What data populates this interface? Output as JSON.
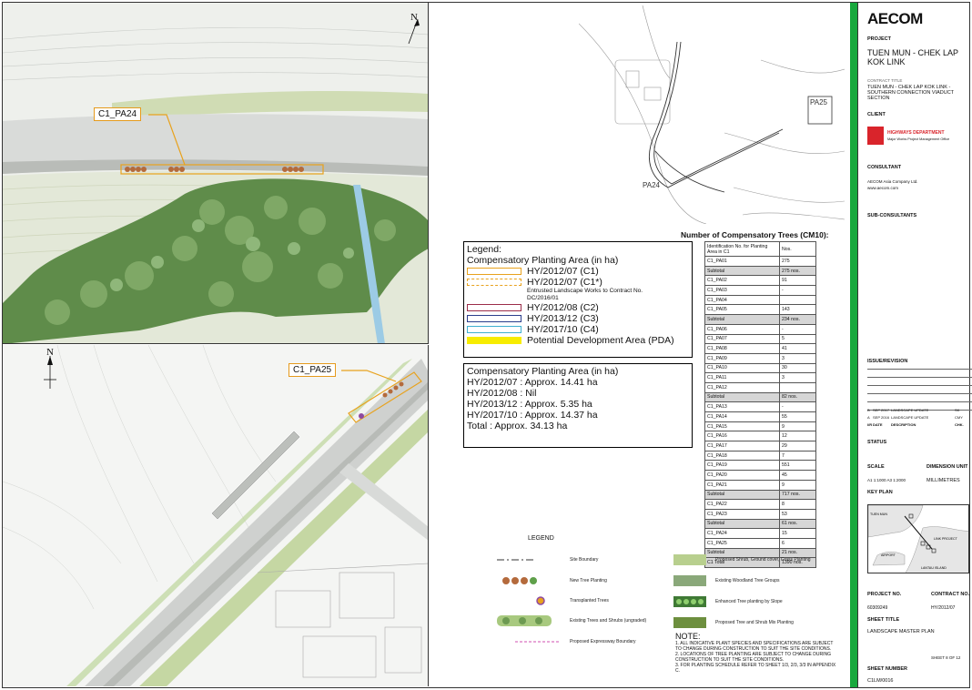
{
  "map_top": {
    "callout": "C1_PA24",
    "north_label": "N"
  },
  "map_bottom": {
    "callout": "C1_PA25",
    "north_label": "N"
  },
  "key_map": {
    "labels": [
      "PA25",
      "PA24"
    ]
  },
  "legend1": {
    "title": "Legend:",
    "subtitle": "Compensatory Planting Area (in ha)",
    "items": [
      {
        "label": "HY/2012/07 (C1)",
        "color": "#e8a21d",
        "style": "solid"
      },
      {
        "label": "HY/2012/07 (C1*)",
        "color": "#e8a21d",
        "style": "dashed"
      },
      {
        "label": "HY/2012/08 (C2)",
        "color": "#9b2d4a",
        "style": "solid"
      },
      {
        "label": "HY/2013/12 (C3)",
        "color": "#2b3e8c",
        "style": "solid"
      },
      {
        "label": "HY/2017/10 (C4)",
        "color": "#3fb0cf",
        "style": "solid"
      },
      {
        "label": "Potential Development Area (PDA)",
        "color": "#f7ec00",
        "style": "fill"
      }
    ],
    "note": "Entrusted Landscape Works to Contract No. DC/2016/01"
  },
  "legend2": {
    "title": "Compensatory Planting Area (in ha)",
    "rows": [
      "HY/2012/07 :  Approx. 14.41 ha",
      "HY/2012/08 :  Nil",
      "HY/2013/12 :  Approx. 5.35 ha",
      "HY/2017/10 :  Approx. 14.37 ha",
      "Total : Approx. 34.13 ha"
    ]
  },
  "trees_table": {
    "title": "Number of Compensatory Trees (CM10):",
    "header": [
      "Identification No. for Planting Area in C1",
      "Nos."
    ],
    "rows": [
      {
        "id": "C1_PA01",
        "n": "275",
        "sub": false
      },
      {
        "id": "Subtotal",
        "n": "275 nos.",
        "sub": true
      },
      {
        "id": "C1_PA02",
        "n": "91",
        "sub": false
      },
      {
        "id": "C1_PA03",
        "n": "-",
        "sub": false
      },
      {
        "id": "C1_PA04",
        "n": "",
        "sub": false
      },
      {
        "id": "C1_PA05",
        "n": "143",
        "sub": false
      },
      {
        "id": "Subtotal",
        "n": "234 nos.",
        "sub": true
      },
      {
        "id": "C1_PA06",
        "n": "-",
        "sub": false
      },
      {
        "id": "C1_PA07",
        "n": "5",
        "sub": false
      },
      {
        "id": "C1_PA08",
        "n": "41",
        "sub": false
      },
      {
        "id": "C1_PA09",
        "n": "3",
        "sub": false
      },
      {
        "id": "C1_PA10",
        "n": "30",
        "sub": false
      },
      {
        "id": "C1_PA11",
        "n": "3",
        "sub": false
      },
      {
        "id": "C1_PA12",
        "n": "",
        "sub": false
      },
      {
        "id": "Subtotal",
        "n": "82 nos.",
        "sub": true
      },
      {
        "id": "C1_PA13",
        "n": "-",
        "sub": false
      },
      {
        "id": "C1_PA14",
        "n": "55",
        "sub": false
      },
      {
        "id": "C1_PA15",
        "n": "9",
        "sub": false
      },
      {
        "id": "C1_PA16",
        "n": "12",
        "sub": false
      },
      {
        "id": "C1_PA17",
        "n": "29",
        "sub": false
      },
      {
        "id": "C1_PA18",
        "n": "7",
        "sub": false
      },
      {
        "id": "C1_PA19",
        "n": "551",
        "sub": false
      },
      {
        "id": "C1_PA20",
        "n": "45",
        "sub": false
      },
      {
        "id": "C1_PA21",
        "n": "9",
        "sub": false
      },
      {
        "id": "Subtotal",
        "n": "717 nos.",
        "sub": true
      },
      {
        "id": "C1_PA22",
        "n": "8",
        "sub": false
      },
      {
        "id": "C1_PA23",
        "n": "53",
        "sub": false
      },
      {
        "id": "Subtotal",
        "n": "61 nos.",
        "sub": true
      },
      {
        "id": "C1_PA24",
        "n": "15",
        "sub": false
      },
      {
        "id": "C1_PA25",
        "n": "6",
        "sub": false
      },
      {
        "id": "Subtotal",
        "n": "21 nos.",
        "sub": true
      },
      {
        "id": "C1 Total",
        "n": "1390 nos.",
        "sub": true
      }
    ]
  },
  "bottom_legend": {
    "title": "LEGEND",
    "left": [
      "Site Boundary",
      "New Tree Planting",
      "Transplanted Trees",
      "Existing Trees and Shrubs (ungraded)",
      "Proposed Expressway Boundary"
    ],
    "right": [
      "Proposed Shrub, Ground cover, Grass Planting",
      "Existing Woodland Tree Groups",
      "Enhanced Tree planting by Slope",
      "Proposed Tree and Shrub Mix Planting"
    ]
  },
  "notes": {
    "title": "NOTE:",
    "lines": [
      "1. ALL INDICATIVE PLANT SPECIES AND SPECIFICATIONS ARE SUBJECT TO CHANGE DURING CONSTRUCTION TO SUIT THE SITE CONDITIONS.",
      "2. LOCATIONS OF TREE PLANTING ARE SUBJECT TO CHANGE DURING CONSTRUCTION TO SUIT THE SITE CONDITIONS.",
      "3. FOR PLANTING SCHEDULE REFER TO SHEET 1/3, 2/3, 3/3 IN APPENDIX C."
    ]
  },
  "title_block": {
    "brand": "AECOM",
    "project_label": "PROJECT",
    "project_name": "TUEN MUN - CHEK LAP KOK LINK",
    "contract_label": "CONTRACT TITLE",
    "contract_title": "TUEN MUN - CHEK LAP KOK LINK - SOUTHERN CONNECTION VIADUCT SECTION",
    "client_label": "CLIENT",
    "client_name": "HIGHWAYS DEPARTMENT",
    "client_sub": "Major Works Project Management Office",
    "consultant_label": "CONSULTANT",
    "consultant_name": "AECOM Asia Company Ltd.",
    "consultant_web": "www.aecom.com",
    "subconsultants_label": "SUB-CONSULTANTS",
    "issue_label": "ISSUE/REVISION",
    "revisions": [
      {
        "rev": "B",
        "date": "SEP 2017",
        "desc": "LANDSCAPE UPDATE",
        "chk": "SK"
      },
      {
        "rev": "A",
        "date": "SEP 2016",
        "desc": "LANDSCAPE UPDATE",
        "chk": "CMY"
      }
    ],
    "rev_headers": [
      "I/R",
      "DATE",
      "DESCRIPTION",
      "CHK."
    ],
    "status_label": "STATUS",
    "scale_label": "SCALE",
    "scale_value": "A1 1:1000 A3 1:2000",
    "dim_label": "DIMENSION UNIT",
    "dim_value": "MILLIMETRES",
    "keyplan_label": "KEY PLAN",
    "keyplan_labels": [
      "TUEN MUN",
      "LINK PROJECT",
      "AIRPORT",
      "LANTAU ISLAND"
    ],
    "project_no_label": "PROJECT NO.",
    "project_no": "60309249",
    "contract_no_label": "CONTRACT NO.",
    "contract_no": "HY/2012/07",
    "sheet_title_label": "SHEET TITLE",
    "sheet_title": "LANDSCAPE MASTER PLAN",
    "sheet_of": "SHEET 8 OF 12",
    "sheet_number_label": "SHEET NUMBER",
    "sheet_number": "C1LM/0016"
  },
  "colors": {
    "green_bar": "#18a83d",
    "accent_orange": "#e8a21d",
    "aecom_red": "#d9242b"
  }
}
